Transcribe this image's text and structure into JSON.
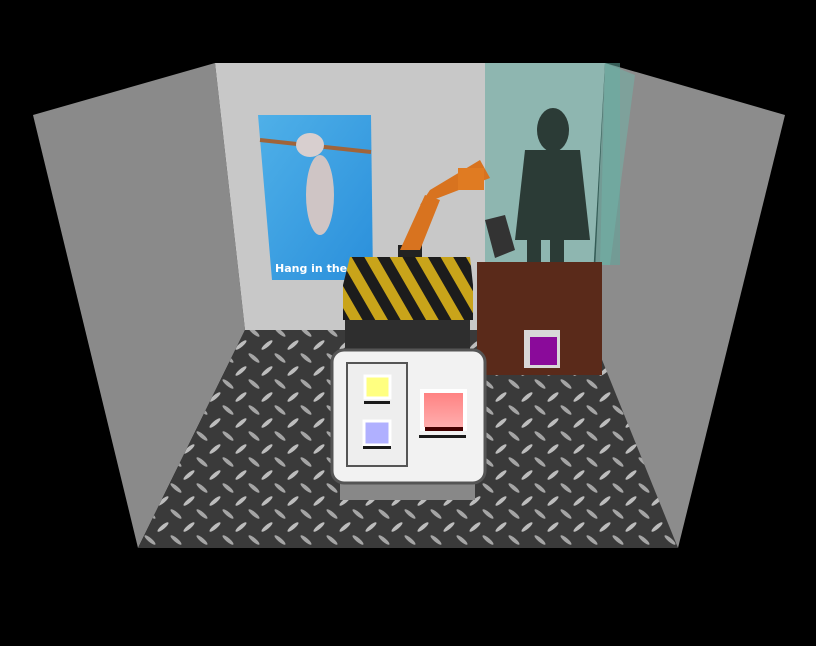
{
  "scene": {
    "poster": {
      "caption": "Hang in there,"
    },
    "control_panel": {
      "buttons": [
        {
          "name": "yellow",
          "color": "#ffff80"
        },
        {
          "name": "blue",
          "color": "#b0b0ff"
        },
        {
          "name": "red",
          "color": "#ff8c8c"
        }
      ]
    },
    "pedestal_button": {
      "color": "#8a0a9a"
    },
    "colors": {
      "background": "#000000",
      "glass": "#5fa89c",
      "pedestal": "#5a2a1a",
      "hazard_yellow": "#c9a41a"
    }
  }
}
